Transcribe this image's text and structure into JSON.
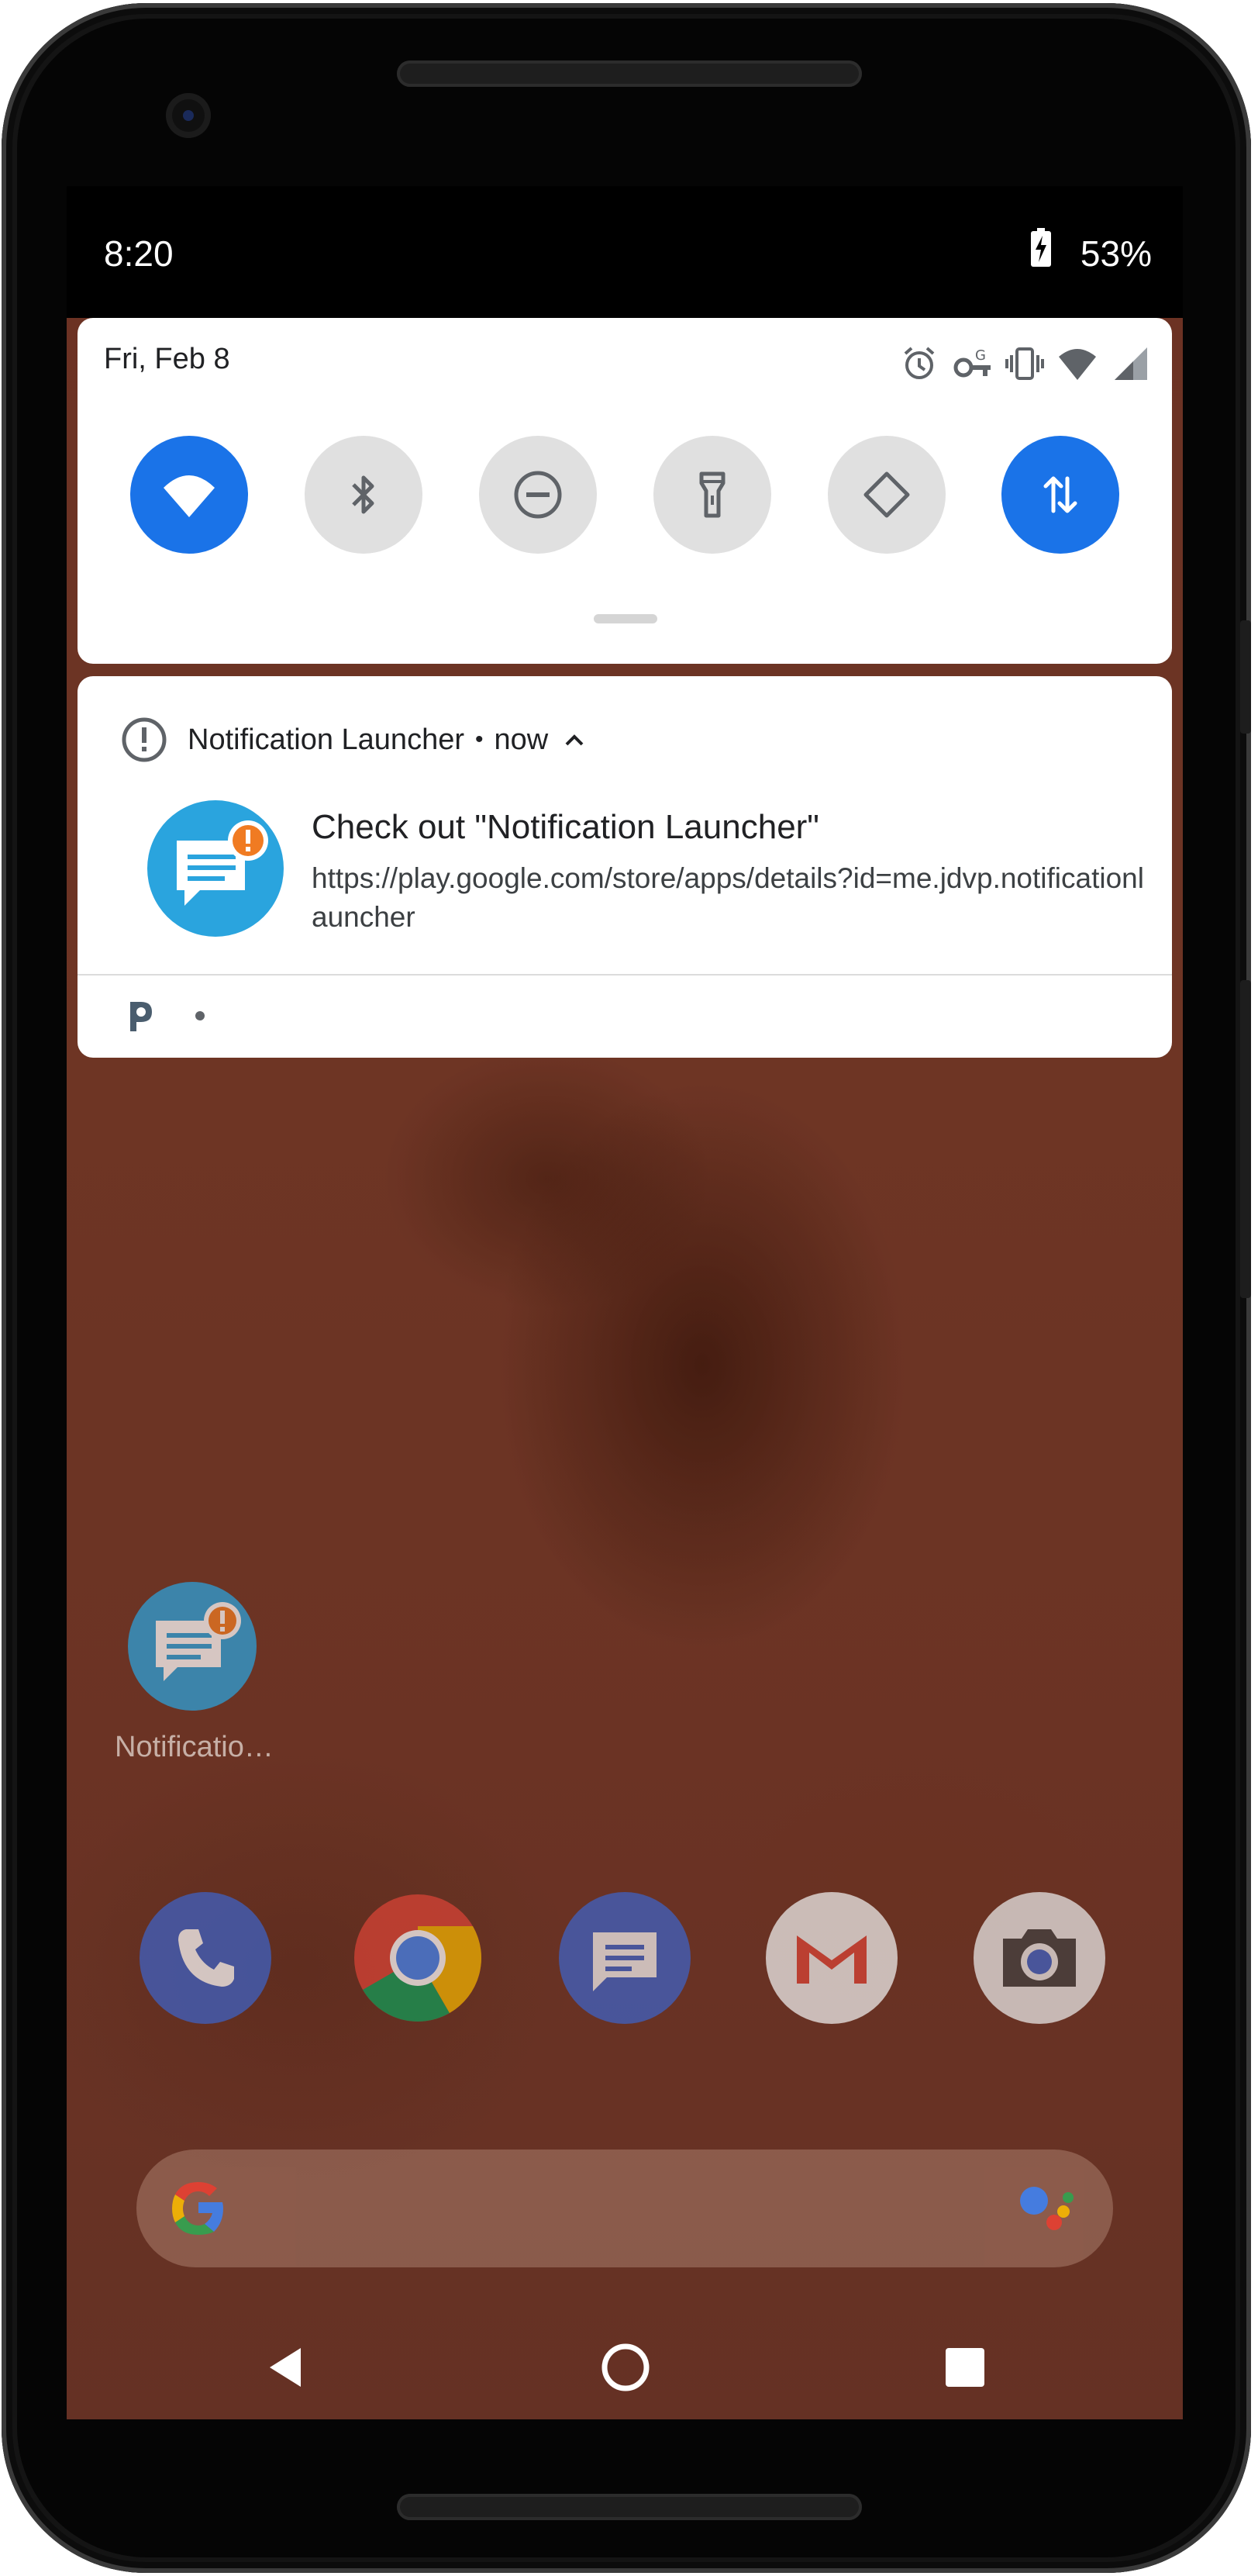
{
  "status_bar": {
    "time": "8:20",
    "battery_percent": "53%",
    "battery_icon": "battery-charging-icon"
  },
  "quick_settings": {
    "date": "Fri, Feb 8",
    "status_icons": [
      "alarm-icon",
      "vpn-key-icon",
      "vibrate-icon",
      "wifi-signal-icon",
      "cell-signal-icon"
    ],
    "tiles": [
      {
        "name": "wifi",
        "icon": "wifi-icon",
        "active": true
      },
      {
        "name": "bluetooth",
        "icon": "bluetooth-icon",
        "active": false
      },
      {
        "name": "do-not-disturb",
        "icon": "do-not-disturb-icon",
        "active": false
      },
      {
        "name": "flashlight",
        "icon": "flashlight-icon",
        "active": false
      },
      {
        "name": "auto-rotate",
        "icon": "auto-rotate-icon",
        "active": false
      },
      {
        "name": "mobile-data",
        "icon": "mobile-data-icon",
        "active": true
      }
    ],
    "accent_color": "#1a73e8",
    "inactive_tile_color": "#e0e0e0"
  },
  "notification": {
    "app_icon": "alert-circle-icon",
    "app_name": "Notification Launcher",
    "separator": "•",
    "time": "now",
    "expand_icon": "chevron-up-icon",
    "title": "Check out \"Notification Launcher\"",
    "text": "https://play.google.com/store/apps/details?id=me.jdvp.notificationlauncher",
    "large_icon": "notification-launcher-icon",
    "footer_icon": "pushbullet-icon"
  },
  "home": {
    "app_label": "Notificatio…",
    "app_icon": "notification-launcher-icon",
    "dock": [
      "phone-icon",
      "chrome-icon",
      "messages-icon",
      "gmail-icon",
      "camera-icon"
    ],
    "search_icons": [
      "google-g-icon",
      "assistant-icon"
    ]
  },
  "nav_bar": {
    "buttons": [
      "back-icon",
      "home-icon",
      "recents-icon"
    ]
  }
}
